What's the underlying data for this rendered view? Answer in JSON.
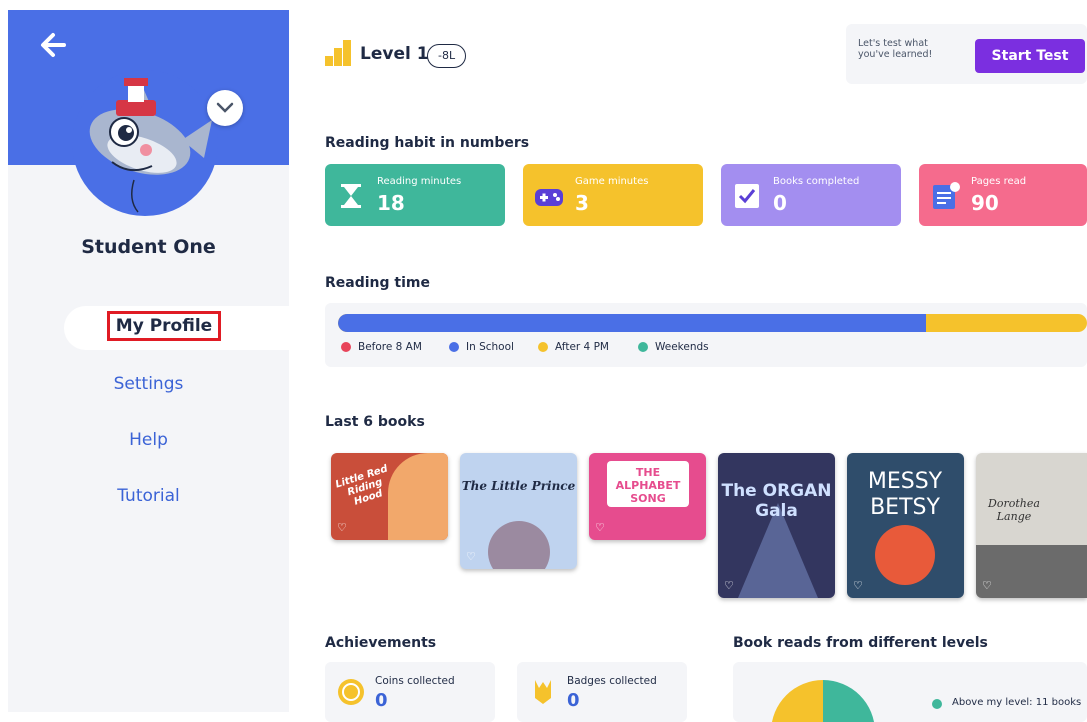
{
  "sidebar": {
    "student_name": "Student One",
    "nav": [
      "My Profile",
      "Settings",
      "Help",
      "Tutorial"
    ]
  },
  "header": {
    "level_label": "Level 1",
    "level_badge": "-8L",
    "test_prompt": "Let's test what you've learned!",
    "start_test": "Start Test"
  },
  "habit": {
    "title": "Reading habit in numbers",
    "stats": [
      {
        "label": "Reading minutes",
        "value": "18",
        "color": "#3fb79b",
        "icon": "hourglass-icon"
      },
      {
        "label": "Game minutes",
        "value": "3",
        "color": "#f5c22c",
        "icon": "gamepad-icon"
      },
      {
        "label": "Books completed",
        "value": "0",
        "color": "#a38ef0",
        "icon": "checkbox-icon"
      },
      {
        "label": "Pages read",
        "value": "90",
        "color": "#f56b8d",
        "icon": "pages-icon"
      }
    ]
  },
  "reading_time": {
    "title": "Reading time",
    "in_school_fraction": 0.785,
    "legend": [
      {
        "label": "Before 8 AM",
        "color": "#e8445a"
      },
      {
        "label": "In School",
        "color": "#4a6fe6"
      },
      {
        "label": "After 4 PM",
        "color": "#f5c22c"
      },
      {
        "label": "Weekends",
        "color": "#3fb79b"
      }
    ]
  },
  "books": {
    "title": "Last 6 books",
    "items": [
      {
        "title": "Little Red Riding Hood",
        "cover": "#c94e3a"
      },
      {
        "title": "The Little Prince",
        "cover": "#bfd3ef"
      },
      {
        "title": "THE ALPHABET SONG",
        "cover": "#e64c8e"
      },
      {
        "title": "The ORGAN Gala",
        "cover": "#33365f"
      },
      {
        "title": "MESSY BETSY",
        "cover": "#2f4d6b"
      },
      {
        "title": "Dorothea Lange",
        "cover": "#d8d6d0"
      }
    ]
  },
  "achievements": {
    "title": "Achievements",
    "items": [
      {
        "label": "Coins collected",
        "value": "0",
        "icon": "coin-icon"
      },
      {
        "label": "Badges collected",
        "value": "0",
        "icon": "badge-icon"
      }
    ]
  },
  "levels": {
    "title": "Book reads from different levels",
    "legend_label": "Above my level: 11 books"
  }
}
